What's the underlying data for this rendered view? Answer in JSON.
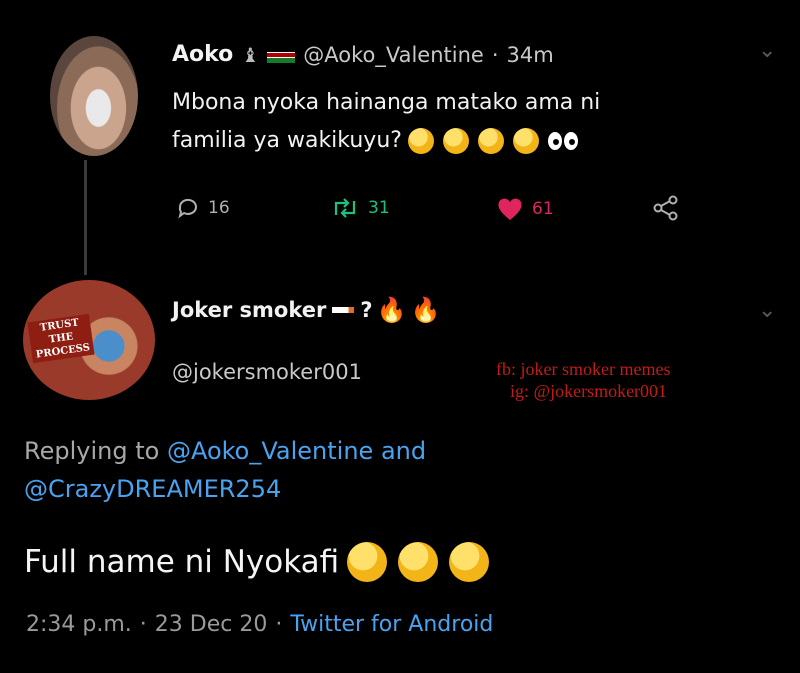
{
  "original_tweet": {
    "name": "Aoko",
    "handle": "@Aoko_Valentine",
    "time": "34m",
    "text_line1": "Mbona nyoka hainanga matako ama ni",
    "text_line2": "familia ya wakikuyu?",
    "reply_count": "16",
    "retweet_count": "31",
    "like_count": "61",
    "colors": {
      "retweet": "#19c37d",
      "like": "#e0245e"
    }
  },
  "reply_tweet": {
    "name": "Joker smoker",
    "name_suffix": "?",
    "handle": "@jokersmoker001",
    "avatar_stamp": [
      "TRUST",
      "THE",
      "PROCESS"
    ],
    "watermark_line1": "fb: joker smoker memes",
    "watermark_line2": "ig: @jokersmoker001",
    "replying_prefix": "Replying to",
    "replying_to_1": "@Aoko_Valentine",
    "replying_and": "and",
    "replying_to_2": "@CrazyDREAMER254",
    "text": "Full name ni Nyokafi",
    "timestamp": "2:34 p.m.",
    "date": "23 Dec 20",
    "source": "Twitter for Android"
  },
  "icons": [
    "chevron-down-icon",
    "reply-icon",
    "retweet-icon",
    "heart-icon",
    "share-icon",
    "kenya-flag-icon",
    "chess-piece-icon",
    "fire-icon",
    "laughing-emoji-icon",
    "grimace-emoji-icon",
    "eyes-emoji-icon"
  ]
}
